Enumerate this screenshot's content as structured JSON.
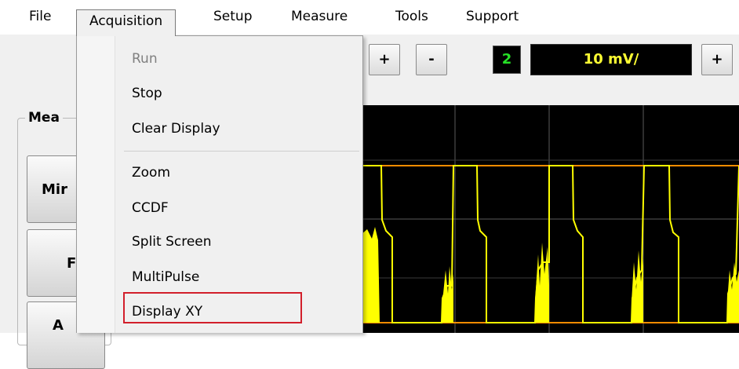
{
  "menubar": {
    "items": [
      "File",
      "Acquisition",
      "Setup",
      "Measure",
      "Tools",
      "Support"
    ]
  },
  "acquisition_menu": {
    "items": [
      {
        "label": "Run",
        "enabled": false
      },
      {
        "label": "Stop",
        "enabled": true
      },
      {
        "label": "Clear Display",
        "enabled": true
      },
      {
        "label": "Zoom",
        "enabled": true
      },
      {
        "label": "CCDF",
        "enabled": true
      },
      {
        "label": "Split Screen",
        "enabled": true
      },
      {
        "label": "MultiPulse",
        "enabled": true
      },
      {
        "label": "Display XY",
        "enabled": true,
        "highlighted": true
      }
    ]
  },
  "toolbar": {
    "timebase_plus": "+",
    "timebase_minus": "-",
    "channel": "2",
    "vertical_scale": "10 mV/",
    "scale_plus": "+"
  },
  "measure_panel": {
    "label_partial": "Mea",
    "buttons": [
      "Mir",
      "F",
      "A"
    ]
  },
  "colors": {
    "trace": "#ffff00",
    "trigger_line": "#ff8c00",
    "channel_text": "#26e026",
    "highlight_box": "#d21f2b"
  }
}
